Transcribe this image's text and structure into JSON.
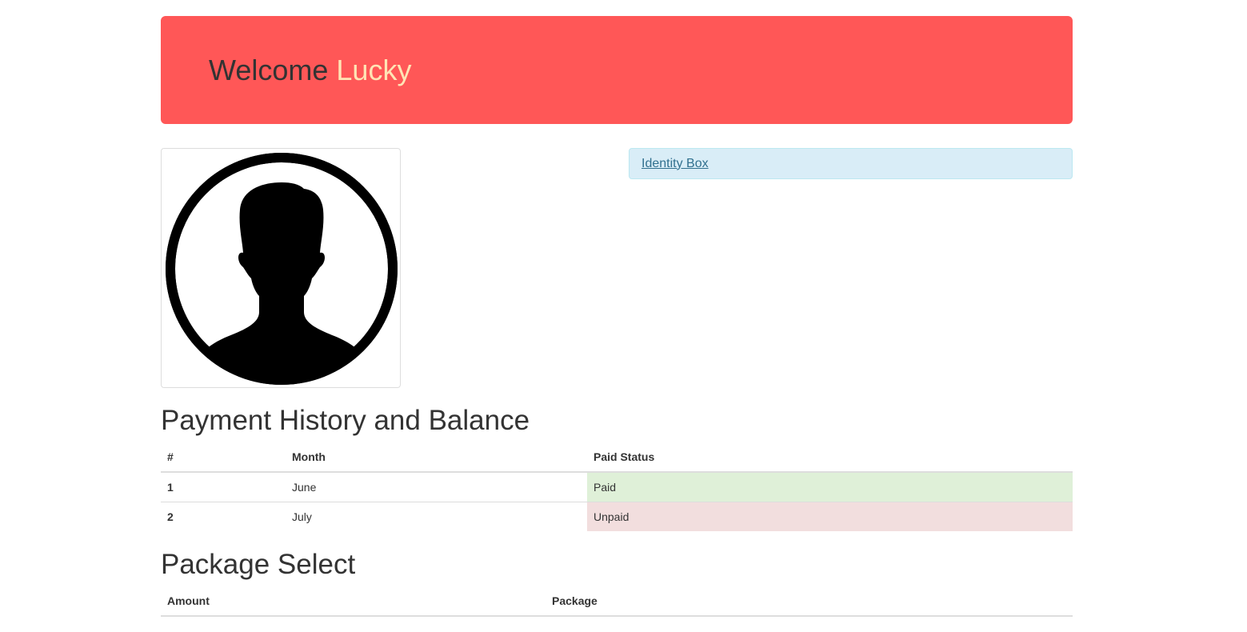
{
  "header": {
    "welcome_prefix": "Welcome",
    "user_name": "Lucky"
  },
  "profile": {
    "avatar_icon": "person-silhouette-icon"
  },
  "identity_box": {
    "label": "Identity Box"
  },
  "payment_section": {
    "title": "Payment History and Balance",
    "columns": [
      "#",
      "Month",
      "Paid Status"
    ],
    "rows": [
      {
        "index": "1",
        "month": "June",
        "status": "Paid",
        "status_color": "#dff0d8"
      },
      {
        "index": "2",
        "month": "July",
        "status": "Unpaid",
        "status_color": "#f2dede"
      }
    ]
  },
  "package_section": {
    "title": "Package Select",
    "columns": [
      "Amount",
      "Package"
    ]
  },
  "colors": {
    "jumbotron_bg": "#ff5757",
    "username_color": "#ffe4b5",
    "identity_bg": "#d9edf7",
    "link_color": "#31708f"
  }
}
